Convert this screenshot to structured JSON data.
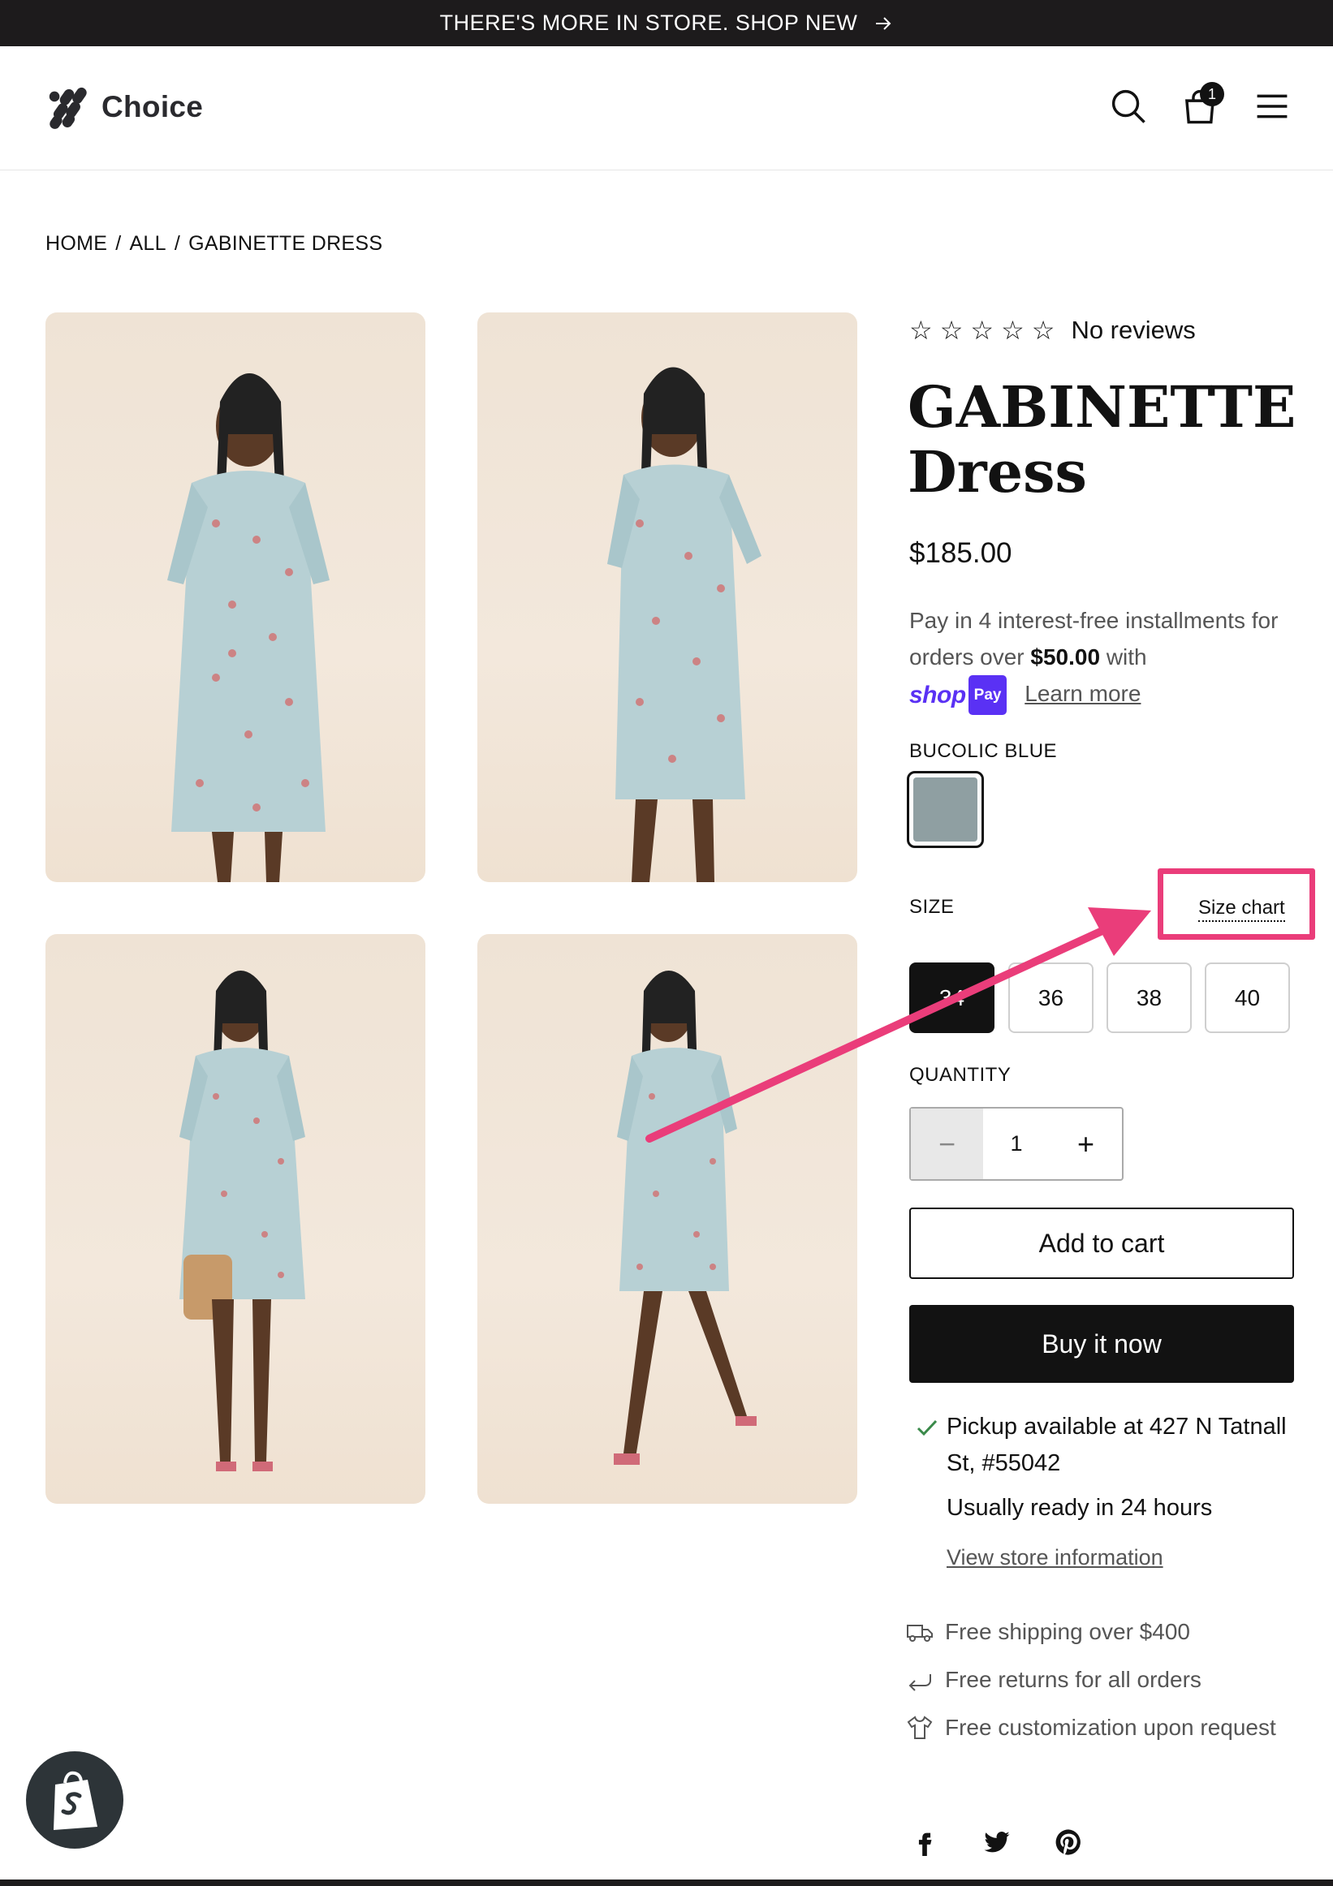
{
  "announcement": {
    "text": "THERE'S MORE IN STORE. SHOP NEW"
  },
  "header": {
    "logo_text": "Choice",
    "cart_count": "1"
  },
  "breadcrumb": [
    "HOME",
    "/",
    "ALL",
    "/",
    "GABINETTE DRESS"
  ],
  "product": {
    "rating": {
      "stars_filled": 0,
      "stars_total": 5,
      "text": "No reviews"
    },
    "title": "GABINETTE Dress",
    "price": "$185.00",
    "installments": {
      "line1": "Pay in 4 interest-free installments for orders over",
      "threshold": "$50.00",
      "with": "with",
      "shop_text": "shop",
      "pay_text": "Pay",
      "learn_more": "Learn more"
    },
    "color": {
      "label": "BUCOLIC BLUE",
      "swatch": "#8f9fa2"
    },
    "size": {
      "label": "SIZE",
      "chart_link": "Size chart",
      "options": [
        "34",
        "36",
        "38",
        "40"
      ],
      "selected": "34"
    },
    "quantity": {
      "label": "QUANTITY",
      "value": "1",
      "minus": "−",
      "plus": "+"
    },
    "add_to_cart": "Add to cart",
    "buy_now": "Buy it now",
    "pickup": {
      "text": "Pickup available at 427 N Tatnall St, #55042",
      "ready": "Usually ready in 24 hours",
      "link": "View store information"
    },
    "perks": [
      {
        "icon": "truck-icon",
        "text": "Free shipping over $400"
      },
      {
        "icon": "return-icon",
        "text": "Free returns for all orders"
      },
      {
        "icon": "shirt-icon",
        "text": "Free customization upon request"
      }
    ]
  },
  "colors": {
    "annotation": "#ea3d7a",
    "shop_pay": "#5a31f4",
    "dark": "#121212"
  }
}
